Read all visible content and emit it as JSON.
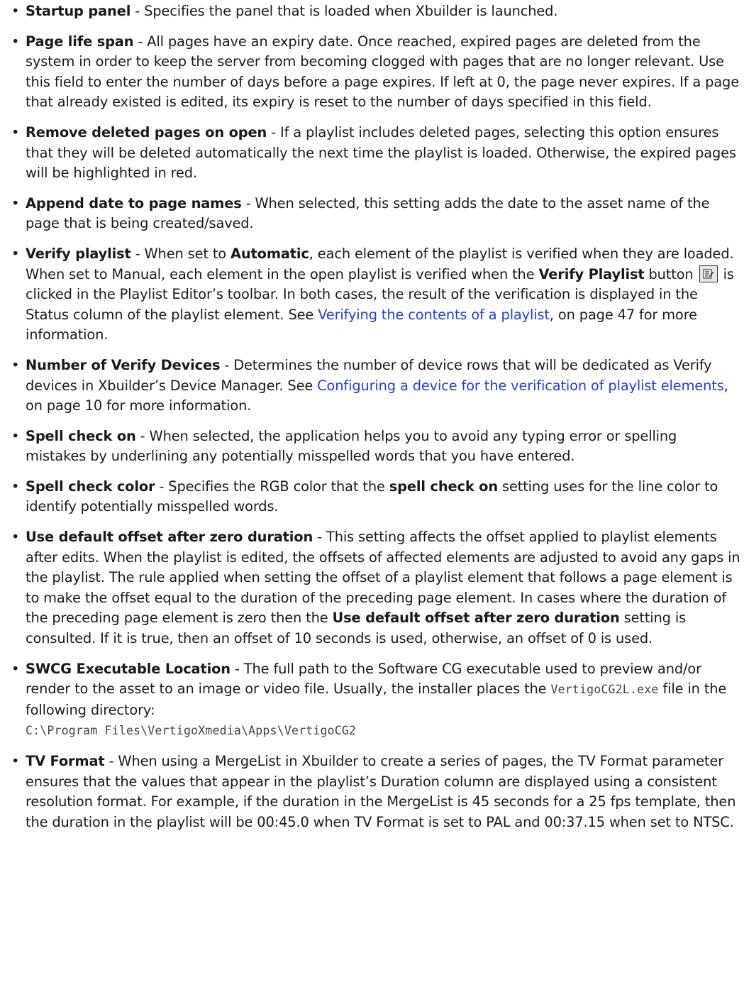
{
  "items": [
    {
      "term": "Startup panel",
      "text": " - Specifies the panel that is loaded when Xbuilder is launched."
    },
    {
      "term": "Page life span",
      "text": " - All pages have an expiry date. Once reached, expired pages are deleted from the system in order to keep the server from becoming clogged with pages that are no longer relevant. Use this field to enter the number of days before a page expires. If left at 0, the page never expires. If a page that already existed is edited, its expiry is reset to the number of days specified in this field."
    },
    {
      "term": "Remove deleted pages on open",
      "text": " - If a playlist includes deleted pages, selecting this option ensures that they will be deleted automatically the next time the playlist is loaded. Otherwise, the expired pages will be highlighted in red."
    },
    {
      "term": "Append date to page names",
      "text": " - When selected, this setting adds the date to the asset name of the page that is being created/saved."
    },
    {
      "term": "Verify playlist",
      "text1": " - When set to ",
      "bold1": "Automatic",
      "text2": ", each element of the playlist is verified when they are loaded. When set to Manual, each element in the open playlist is verified when the ",
      "bold2": "Verify Playlist",
      "text3": " button ",
      "text4": " is clicked in the Playlist Editor’s toolbar. In both cases, the result of the verification is displayed in the Status column of the playlist element. See ",
      "link": "Verifying the contents of a playlist",
      "text5": ", on page 47 for more information."
    },
    {
      "term": "Number of Verify Devices",
      "text1": " - Determines the number of device rows that will be dedicated as Verify devices in Xbuilder’s Device Manager. See ",
      "link": "Configuring a device for the verification of playlist elements",
      "text2": ", on page 10 for more information."
    },
    {
      "term": "Spell check on",
      "text": " - When selected, the application helps you to avoid any typing error or spelling mistakes by underlining any potentially misspelled words that you have entered."
    },
    {
      "term": "Spell check color",
      "text1": " - Specifies the RGB color that the ",
      "bold1": "spell check on",
      "text2": " setting uses for the line color to identify potentially misspelled words."
    },
    {
      "term": "Use default offset after zero duration",
      "text1": " - This setting affects the offset applied to playlist elements after edits. When the playlist is edited, the offsets of affected elements are adjusted to avoid any gaps in the playlist. The rule applied when setting the offset of a playlist element that follows a page element is to make the offset equal to the duration of the preceding page element. In cases where the duration of the preceding page element is zero then the ",
      "bold1": "Use default offset after zero duration",
      "text2": " setting is consulted. If it is true, then an offset of 10 seconds is used, otherwise, an offset of 0 is used."
    },
    {
      "term": "SWCG Executable Location",
      "text1": " - The full path to the Software CG executable used to preview and/or render to the asset to an image or video file. Usually, the installer places the ",
      "code1": "VertigoCG2L.exe",
      "text2": " file in the following directory:",
      "code2": "C:\\Program Files\\VertigoXmedia\\Apps\\VertigoCG2"
    },
    {
      "term": "TV Format",
      "text": " - When using a MergeList in Xbuilder to create a series of pages, the TV Format parameter ensures that the values that appear in the playlist’s Duration column are displayed using a consistent resolution format. For example, if the duration in the MergeList is 45 seconds for a 25 fps template, then the duration in the playlist will be 00:45.0 when TV Format is set to PAL and 00:37.15 when set to NTSC."
    }
  ],
  "bullet": "•",
  "icons": {
    "verify_playlist_button": "verify-playlist-icon"
  }
}
